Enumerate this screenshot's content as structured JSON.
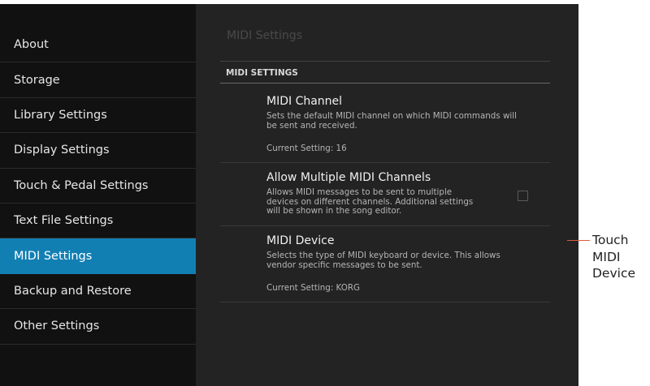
{
  "sidebar": {
    "items": [
      {
        "label": "About"
      },
      {
        "label": "Storage"
      },
      {
        "label": "Library Settings"
      },
      {
        "label": "Display Settings"
      },
      {
        "label": "Touch & Pedal Settings"
      },
      {
        "label": "Text File Settings"
      },
      {
        "label": "MIDI Settings",
        "active": true
      },
      {
        "label": "Backup and Restore"
      },
      {
        "label": "Other Settings"
      }
    ]
  },
  "content": {
    "title": "MIDI Settings",
    "section_header": "MIDI SETTINGS",
    "settings": [
      {
        "title": "MIDI Channel",
        "desc_lines": [
          "Sets the default MIDI channel on which MIDI commands will",
          "be sent and received."
        ],
        "current": "Current Setting: 16"
      },
      {
        "title": "Allow Multiple MIDI Channels",
        "desc_lines": [
          "Allows MIDI messages to be sent to multiple",
          "devices on different channels. Additional settings",
          "will be shown in the song editor."
        ],
        "checked": false
      },
      {
        "title": "MIDI Device",
        "desc_lines": [
          "Selects the type of MIDI keyboard or device. This allows",
          "vendor specific messages to be sent."
        ],
        "current": "Current Setting: KORG"
      }
    ]
  },
  "callout": {
    "lines": [
      "Touch",
      "MIDI",
      "Device"
    ],
    "color": "#e05a3a"
  },
  "colors": {
    "accent": "#127fb3",
    "background": "#232323",
    "sidebar": "#111111"
  }
}
